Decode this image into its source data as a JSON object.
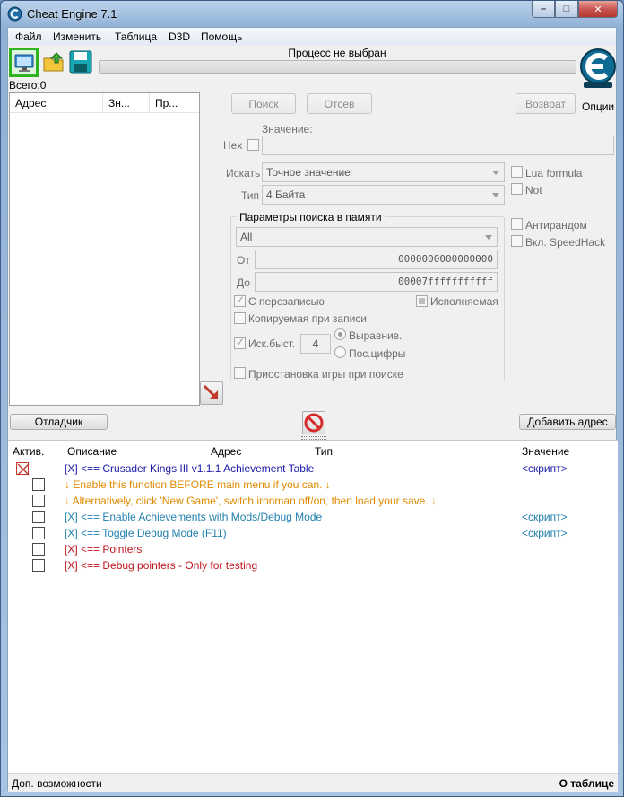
{
  "window": {
    "title": "Cheat Engine 7.1",
    "minimize": "–",
    "maximize": "□",
    "close": "✕"
  },
  "menu": [
    "Файл",
    "Изменить",
    "Таблица",
    "D3D",
    "Помощь"
  ],
  "toolbar": {
    "icons": [
      "open-process-icon",
      "open-file-icon",
      "save-icon"
    ]
  },
  "process": {
    "label": "Процесс не выбран",
    "progress": 0
  },
  "options_label": "Опции",
  "found_count": "Всего:0",
  "results_list": {
    "columns": [
      "Адрес",
      "Зн...",
      "Пр..."
    ]
  },
  "scan": {
    "first_scan": "Поиск",
    "next_scan": "Отсев",
    "undo_scan": "Возврат",
    "value_label": "Значение:",
    "hex_label": "Hex",
    "scan_type_label": "Искать",
    "scan_type_value": "Точное значение",
    "value_type_label": "Тип",
    "value_type_value": "4 Байта",
    "lua_formula": "Lua formula",
    "not_label": "Not",
    "unrandomizer": "Антирандом",
    "speedhack": "Вкл. SpeedHack"
  },
  "memory_options": {
    "title": "Параметры поиска в памяти",
    "region": "All",
    "from_label": "От",
    "from_value": "0000000000000000",
    "to_label": "До",
    "to_value": "00007fffffffffff",
    "writable": "С перезаписью",
    "executable": "Исполняемая",
    "copy_on_write": "Копируемая при записи",
    "fast_scan": "Иск.быст.",
    "fast_scan_value": "4",
    "alignment": "Выравнив.",
    "last_digits": "Пос.цифры",
    "pause_game": "Приостановка игры при поиске"
  },
  "buttons": {
    "debugger": "Отладчик",
    "add_address": "Добавить адрес"
  },
  "address_table": {
    "columns": [
      "Актив.",
      "Описание",
      "Адрес",
      "Тип",
      "Значение"
    ],
    "rows": [
      {
        "desc": "[X] <== Crusader Kings III v1.1.1 Achievement Table",
        "value": "<скрипт>",
        "color": "#1a1aa8",
        "indent": 0,
        "active": true
      },
      {
        "desc": "↓ Enable this function BEFORE main menu if you can. ↓",
        "value": "",
        "color": "#e08a00",
        "indent": 1,
        "active": false
      },
      {
        "desc": "↓ Alternatively, click 'New Game', switch ironman off/on, then load your save. ↓",
        "value": "",
        "color": "#e08a00",
        "indent": 1,
        "active": false
      },
      {
        "desc": "[X] <== Enable Achievements with Mods/Debug Mode",
        "value": "<скрипт>",
        "color": "#1f7fae",
        "indent": 1,
        "active": false
      },
      {
        "desc": "[X] <== Toggle Debug Mode (F11)",
        "value": "<скрипт>",
        "color": "#1f7fae",
        "indent": 1,
        "active": false
      },
      {
        "desc": "[X] <== Pointers",
        "value": "",
        "color": "#c0141c",
        "indent": 1,
        "active": false
      },
      {
        "desc": "[X] <== Debug pointers - Only for testing",
        "value": "",
        "color": "#c0141c",
        "indent": 1,
        "active": false
      }
    ]
  },
  "status": {
    "advanced": "Доп. возможности",
    "table_extras": "О таблице"
  }
}
